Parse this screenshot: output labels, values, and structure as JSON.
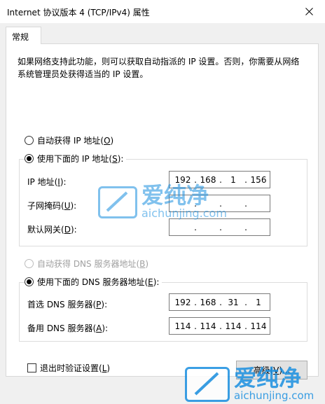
{
  "window": {
    "title": "Internet 协议版本 4 (TCP/IPv4) 属性"
  },
  "tabs": [
    {
      "label": "常规",
      "selected": true
    }
  ],
  "description": "如果网络支持此功能，则可以获取自动指派的 IP 设置。否则，你需要从网络系统管理员处获得适当的 IP 设置。",
  "ip_section": {
    "auto_option": {
      "label_before": "自动获得 IP 地址(",
      "hotkey": "O",
      "label_after": ")",
      "checked": false
    },
    "manual_option": {
      "label_before": "使用下面的 IP 地址(",
      "hotkey": "S",
      "label_after": "):",
      "checked": true
    },
    "fields": {
      "ip": {
        "label_before": "IP 地址(",
        "hotkey": "I",
        "label_after": "):",
        "octets": [
          "192",
          "168",
          "1",
          "156"
        ]
      },
      "mask": {
        "label_before": "子网掩码(",
        "hotkey": "U",
        "label_after": "):",
        "octets": [
          "",
          "",
          "",
          ""
        ]
      },
      "gateway": {
        "label_before": "默认网关(",
        "hotkey": "D",
        "label_after": "):",
        "octets": [
          "",
          "",
          "",
          ""
        ]
      }
    }
  },
  "dns_section": {
    "auto_option": {
      "label_before": "自动获得 DNS 服务器地址(",
      "hotkey": "B",
      "label_after": ")",
      "checked": false,
      "disabled": true
    },
    "manual_option": {
      "label_before": "使用下面的 DNS 服务器地址(",
      "hotkey": "E",
      "label_after": "):",
      "checked": true
    },
    "fields": {
      "preferred": {
        "label_before": "首选 DNS 服务器(",
        "hotkey": "P",
        "label_after": "):",
        "octets": [
          "192",
          "168",
          "31",
          "1"
        ]
      },
      "alternate": {
        "label_before": "备用 DNS 服务器(",
        "hotkey": "A",
        "label_after": "):",
        "octets": [
          "114",
          "114",
          "114",
          "114"
        ]
      }
    }
  },
  "validate_on_exit": {
    "label_before": "退出时验证设置(",
    "hotkey": "L",
    "label_after": ")",
    "checked": false
  },
  "advanced_button": {
    "label_before": "高级(",
    "hotkey": "V",
    "label_after": ")..."
  },
  "watermarks": [
    {
      "brand": "爱纯净",
      "url": "aichunjing.com"
    },
    {
      "brand": "爱纯净",
      "url": "aichunjing.com"
    }
  ],
  "colors": {
    "accent": "#1a8fe0",
    "panel_bg": "#f0f0f0",
    "button_bg": "#e1e1e1"
  },
  "icons": {
    "close": "close-icon"
  }
}
